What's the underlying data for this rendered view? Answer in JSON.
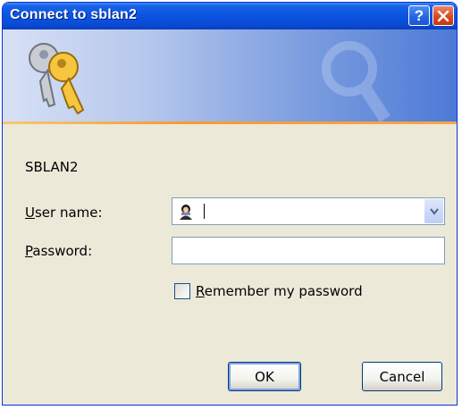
{
  "window": {
    "title": "Connect to sblan2",
    "help_label": "?"
  },
  "dialog": {
    "server_name": "SBLAN2",
    "username_label_mnemonic": "U",
    "username_label_rest": "ser name:",
    "username_value": "",
    "password_label_mnemonic": "P",
    "password_label_rest": "assword:",
    "password_value": "",
    "remember_mnemonic": "R",
    "remember_rest": "emember my password",
    "remember_checked": false
  },
  "buttons": {
    "ok_label": "OK",
    "cancel_label": "Cancel"
  },
  "icons": {
    "banner": "keys-icon",
    "user": "user-icon",
    "help": "help-icon",
    "close": "close-icon",
    "dropdown": "chevron-down-icon"
  },
  "colors": {
    "titlebar": "#0a53e0",
    "banner_accent": "#f79a32",
    "dialog_bg": "#ece9d8"
  }
}
